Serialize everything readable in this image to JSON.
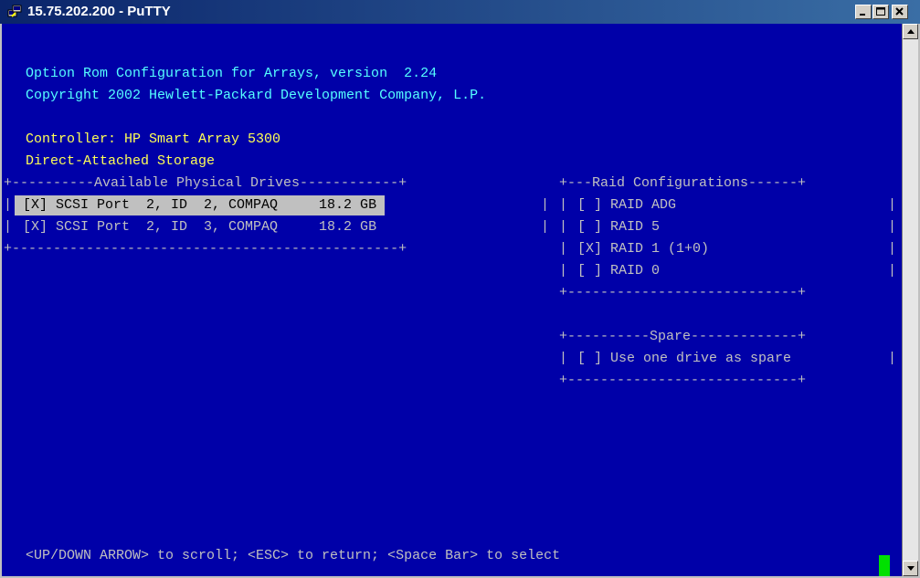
{
  "window": {
    "title": "15.75.202.200 - PuTTY",
    "icon": "putty-icon",
    "buttons": {
      "minimize": "minimize-icon",
      "maximize": "maximize-icon",
      "close": "close-icon"
    }
  },
  "terminal": {
    "header_line1": "Option Rom Configuration for Arrays, version  2.24",
    "header_line2": "Copyright 2002 Hewlett-Packard Development Company, L.P.",
    "controller": "Controller: HP Smart Array 5300",
    "storage": "Direct-Attached Storage",
    "drives_panel": {
      "top_border": "+----------Available Physical Drives------------+",
      "rows": [
        {
          "text": " [X] SCSI Port  2, ID  2, COMPAQ     18.2 GB ",
          "selected": true
        },
        {
          "text": " [X] SCSI Port  2, ID  3, COMPAQ     18.2 GB ",
          "selected": false
        }
      ],
      "bottom_border": "+-----------------------------------------------+"
    },
    "raid_panel": {
      "top_border": "+---Raid Configurations------+",
      "options": [
        "[ ] RAID ADG",
        "[ ] RAID 5",
        "[X] RAID 1 (1+0)",
        "[ ] RAID 0"
      ],
      "bottom_border": "+----------------------------+"
    },
    "spare_panel": {
      "top_border": "+----------Spare-------------+",
      "option": "[ ] Use one drive as spare",
      "bottom_border": "+----------------------------+"
    },
    "footer": "<UP/DOWN ARROW> to scroll; <ESC> to return; <Space Bar> to select"
  },
  "colors": {
    "terminal_bg": "#0000a8",
    "text_gray": "#c0c0c0",
    "text_yellow": "#ffff55",
    "text_cyan": "#55ffff",
    "cursor_green": "#00e000"
  }
}
